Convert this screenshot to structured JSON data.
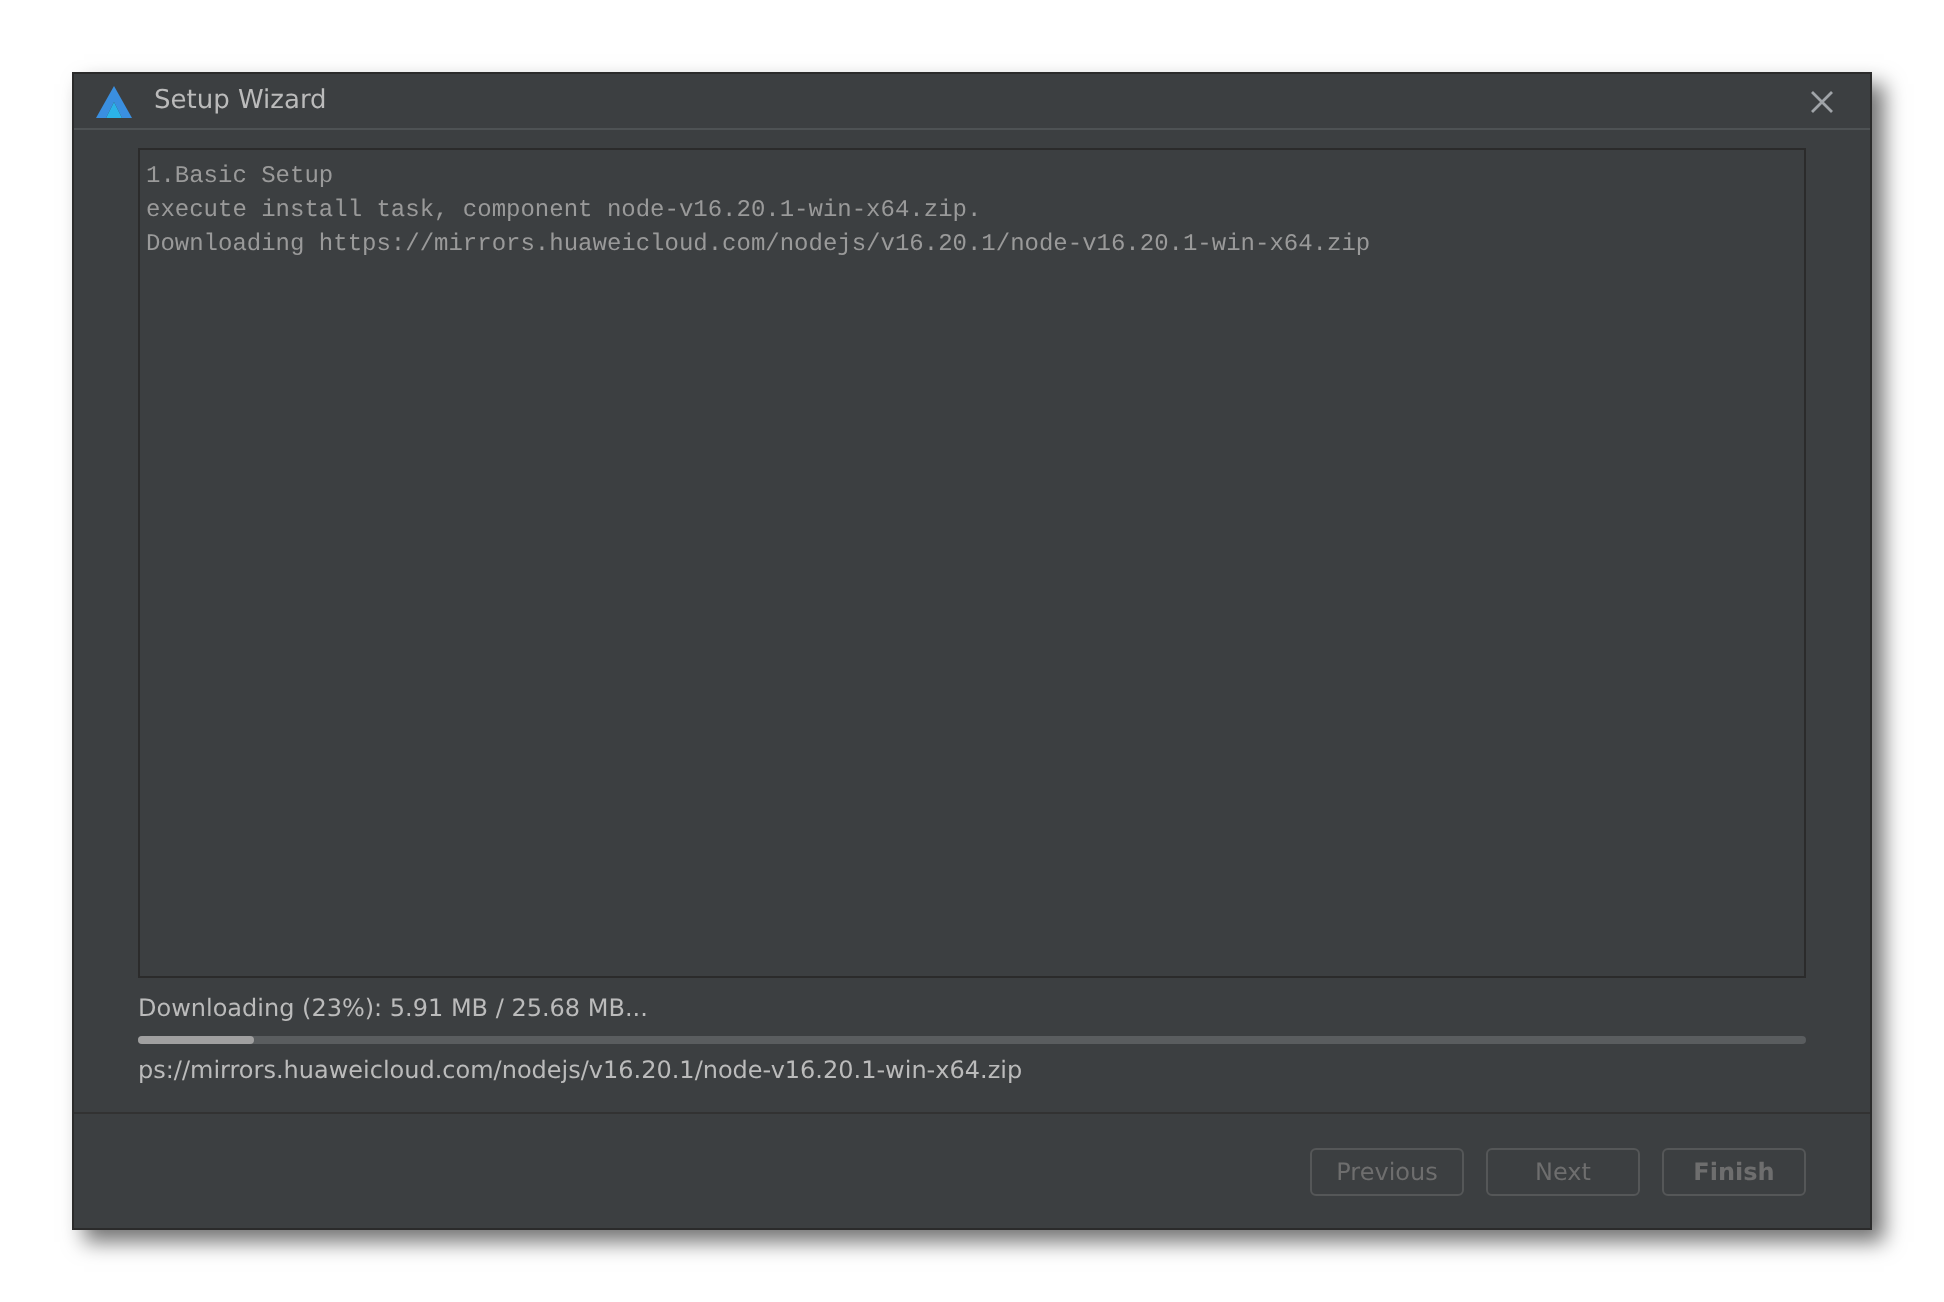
{
  "window": {
    "title": "Setup Wizard"
  },
  "log": {
    "lines": [
      "1.Basic Setup",
      "execute install task, component node-v16.20.1-win-x64.zip.",
      "Downloading https://mirrors.huaweicloud.com/nodejs/v16.20.1/node-v16.20.1-win-x64.zip"
    ]
  },
  "progress": {
    "status": "Downloading (23%): 5.91 MB / 25.68 MB...",
    "level": 0.07,
    "detail": "ps://mirrors.huaweicloud.com/nodejs/v16.20.1/node-v16.20.1-win-x64.zip"
  },
  "buttons": [
    {
      "label": "Previous",
      "disabled": true,
      "default": false
    },
    {
      "label": "Next",
      "disabled": true,
      "default": false
    },
    {
      "label": "Finish",
      "disabled": true,
      "default": true
    }
  ]
}
